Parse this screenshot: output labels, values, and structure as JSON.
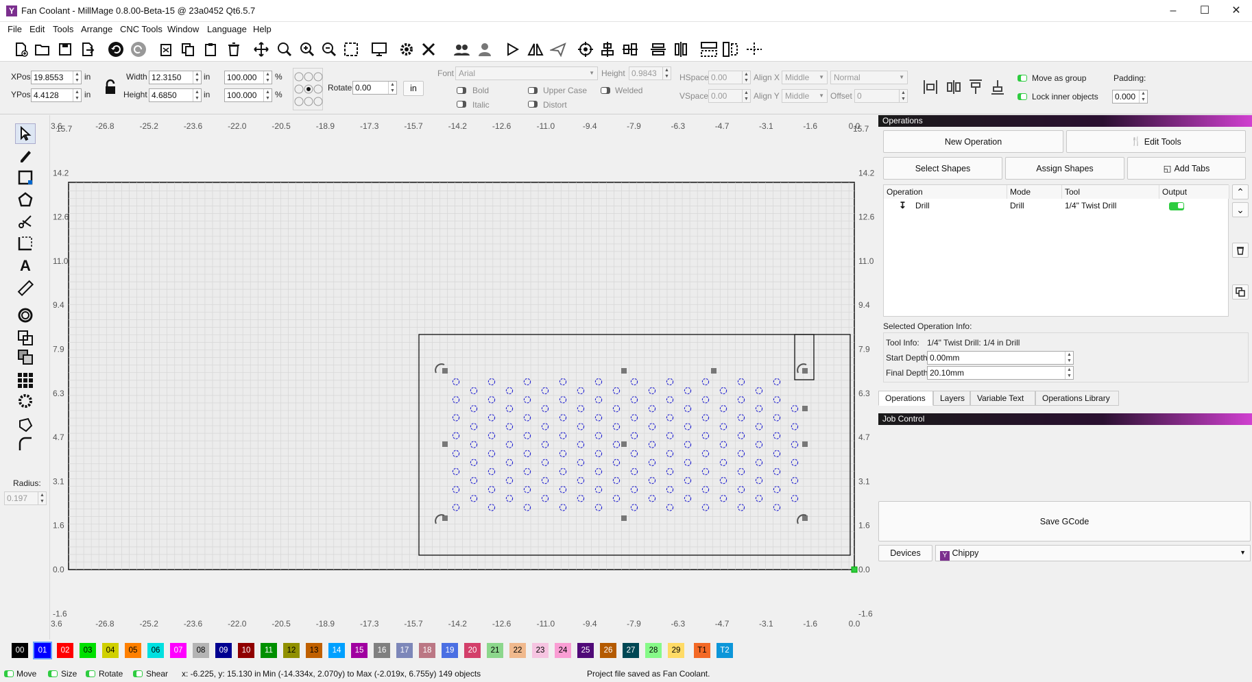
{
  "window": {
    "title": "Fan Coolant - MillMage 0.8.00-Beta-15 @ 23a0452 Qt6.5.7"
  },
  "menu": [
    "File",
    "Edit",
    "Tools",
    "Arrange",
    "CNC Tools",
    "Window",
    "Language",
    "Help"
  ],
  "props": {
    "xpos_label": "XPos",
    "xpos": "19.8553",
    "ypos_label": "YPos",
    "ypos": "4.4128",
    "unit": "in",
    "width_label": "Width",
    "width": "12.3150",
    "height_label": "Height",
    "height": "4.6850",
    "scale_w": "100.000",
    "scale_h": "100.000",
    "percent": "%",
    "rotate_label": "Rotate",
    "rotate": "0.00",
    "in_button": "in",
    "font_label": "Font",
    "font": "Arial",
    "font_height_label": "Height",
    "font_height": "0.9843",
    "hspace_label": "HSpace",
    "hspace": "0.00",
    "vspace_label": "VSpace",
    "vspace": "0.00",
    "alignx_label": "Align X",
    "alignx": "Middle",
    "aligny_label": "Align Y",
    "aligny": "Middle",
    "style": "Normal",
    "offset_label": "Offset",
    "offset": "0",
    "bold": "Bold",
    "italic": "Italic",
    "upper_case": "Upper Case",
    "distort": "Distort",
    "welded": "Welded",
    "move_as_group": "Move as group",
    "lock_inner": "Lock inner objects",
    "padding_label": "Padding:",
    "padding": "0.000"
  },
  "left": {
    "radius_label": "Radius:",
    "radius": "0.197"
  },
  "ruler": {
    "x_ticks": [
      "-26.8",
      "-25.2",
      "-23.6",
      "-22.0",
      "-20.5",
      "-18.9",
      "-17.3",
      "-15.7",
      "-14.2",
      "-12.6",
      "-11.0",
      "-9.4",
      "-7.9",
      "-6.3",
      "-4.7",
      "-3.1",
      "-1.6",
      "0.0"
    ],
    "y_ticks": [
      "14.2",
      "12.6",
      "11.0",
      "9.4",
      "7.9",
      "6.3",
      "4.7",
      "3.1",
      "1.6",
      "0.0",
      "-1.6"
    ],
    "corner_left": "3.6",
    "corner_top_left": "15.7",
    "corner_top_right": "15.7"
  },
  "operations": {
    "header": "Operations",
    "new_operation": "New Operation",
    "edit_tools": "Edit Tools",
    "select_shapes": "Select Shapes",
    "assign_shapes": "Assign Shapes",
    "add_tabs": "Add Tabs",
    "columns": [
      "Operation",
      "Mode",
      "Tool",
      "Output"
    ],
    "rows": [
      {
        "operation": "Drill",
        "mode": "Drill",
        "tool": "1/4\" Twist Drill",
        "output": "on"
      }
    ],
    "selected_info_label": "Selected Operation Info:",
    "tool_info_label": "Tool Info:",
    "tool_info": "1/4\" Twist Drill: 1/4 in Drill",
    "start_depth_label": "Start Depth:",
    "start_depth": "0.00mm",
    "final_depth_label": "Final Depth:",
    "final_depth": "20.10mm",
    "tabs": [
      "Operations",
      "Layers",
      "Variable Text",
      "Operations Library"
    ]
  },
  "job": {
    "header": "Job Control",
    "save_gcode": "Save GCode",
    "devices": "Devices",
    "device": "Chippy"
  },
  "palette": [
    {
      "label": "00",
      "bg": "#000000",
      "fg": "#ffffff"
    },
    {
      "label": "01",
      "bg": "#0000ff",
      "fg": "#ffffff"
    },
    {
      "label": "02",
      "bg": "#ff0000",
      "fg": "#ffffff"
    },
    {
      "label": "03",
      "bg": "#00e000",
      "fg": "#000000"
    },
    {
      "label": "04",
      "bg": "#d0d000",
      "fg": "#000000"
    },
    {
      "label": "05",
      "bg": "#ff8000",
      "fg": "#000000"
    },
    {
      "label": "06",
      "bg": "#00e0e0",
      "fg": "#000000"
    },
    {
      "label": "07",
      "bg": "#ff00ff",
      "fg": "#ffffff"
    },
    {
      "label": "08",
      "bg": "#b4b4b4",
      "fg": "#000000"
    },
    {
      "label": "09",
      "bg": "#000090",
      "fg": "#ffffff"
    },
    {
      "label": "10",
      "bg": "#900000",
      "fg": "#ffffff"
    },
    {
      "label": "11",
      "bg": "#009000",
      "fg": "#ffffff"
    },
    {
      "label": "12",
      "bg": "#909000",
      "fg": "#000000"
    },
    {
      "label": "13",
      "bg": "#c06000",
      "fg": "#000000"
    },
    {
      "label": "14",
      "bg": "#00a0ff",
      "fg": "#ffffff"
    },
    {
      "label": "15",
      "bg": "#a000a0",
      "fg": "#ffffff"
    },
    {
      "label": "16",
      "bg": "#808080",
      "fg": "#ffffff"
    },
    {
      "label": "17",
      "bg": "#7d87b9",
      "fg": "#ffffff"
    },
    {
      "label": "18",
      "bg": "#bb7784",
      "fg": "#ffffff"
    },
    {
      "label": "19",
      "bg": "#4a6fe3",
      "fg": "#ffffff"
    },
    {
      "label": "20",
      "bg": "#d33f6a",
      "fg": "#ffffff"
    },
    {
      "label": "21",
      "bg": "#8cd78c",
      "fg": "#000000"
    },
    {
      "label": "22",
      "bg": "#f0b98d",
      "fg": "#000000"
    },
    {
      "label": "23",
      "bg": "#f6c4e1",
      "fg": "#000000"
    },
    {
      "label": "24",
      "bg": "#fa9ed4",
      "fg": "#000000"
    },
    {
      "label": "25",
      "bg": "#500a78",
      "fg": "#ffffff"
    },
    {
      "label": "26",
      "bg": "#b45a00",
      "fg": "#ffffff"
    },
    {
      "label": "27",
      "bg": "#004754",
      "fg": "#ffffff"
    },
    {
      "label": "28",
      "bg": "#86fa88",
      "fg": "#000000"
    },
    {
      "label": "29",
      "bg": "#ffdb66",
      "fg": "#000000"
    },
    {
      "label": "T1",
      "bg": "#f36926",
      "fg": "#000000"
    },
    {
      "label": "T2",
      "bg": "#0c96d9",
      "fg": "#ffffff"
    }
  ],
  "status": {
    "move": "Move",
    "size": "Size",
    "rotate": "Rotate",
    "shear": "Shear",
    "coords": "x: -6.225, y: 15.130 in",
    "bounds": "Min (-14.334x, 2.070y) to Max (-2.019x, 6.755y)  149 objects",
    "message": "Project file saved as Fan Coolant."
  },
  "colors": {
    "accent_green": "#2ecc40",
    "hole": "#2020d0",
    "grid_bg": "#ececec"
  }
}
